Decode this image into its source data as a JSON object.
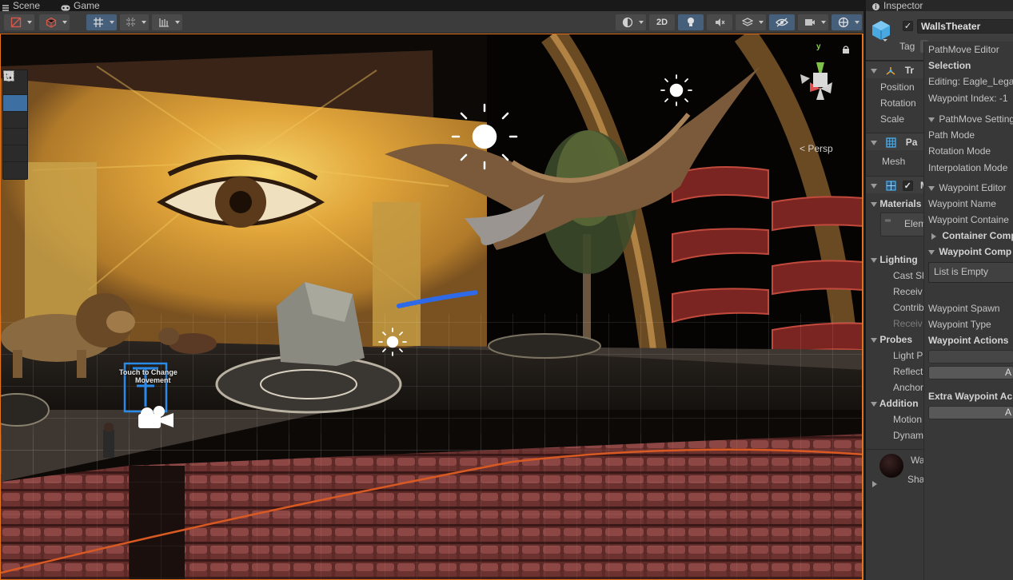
{
  "tabs": {
    "scene": "Scene",
    "game": "Game",
    "inspector": "Inspector"
  },
  "toolbar": {
    "two_d": "2D"
  },
  "viewport": {
    "persp_label": "< Persp",
    "gizmo_axes": {
      "y": "y"
    },
    "stage_sign_title": "Touch to Change",
    "stage_sign_subtitle": "Movement"
  },
  "inspector": {
    "object_name": "WallsTheater",
    "tag_label": "Tag",
    "components": {
      "transform": {
        "title": "Tr",
        "position": "Position",
        "rotation": "Rotation",
        "scale": "Scale"
      },
      "mesh_filter": {
        "title": "Pa",
        "mesh": "Mesh"
      },
      "mesh_renderer": {
        "title": "Me",
        "materials": "Materials",
        "element": "Elem",
        "lighting": "Lighting",
        "cast_shadows": "Cast Sh",
        "receive_shadows": "Receiv",
        "contribute_gi": "Contrib",
        "receive_gi": "Receiv",
        "probes": "Probes",
        "light_probes": "Light P",
        "reflection_probes": "Reflect",
        "anchor_override": "Anchor",
        "additional": "Addition",
        "motion_vectors": "Motion",
        "dynamic_occlusion": "Dynam"
      },
      "material": {
        "name": "Wa",
        "shader": "Sha"
      }
    }
  },
  "pathmove": {
    "title": "PathMove Editor",
    "selection_header": "Selection",
    "editing": "Editing: Eagle_Lega",
    "waypoint_index": "Waypoint Index: -1",
    "settings_header": "PathMove Setting",
    "path_mode": "Path Mode",
    "rotation_mode": "Rotation Mode",
    "interpolation_mode": "Interpolation Mode",
    "waypoint_editor_header": "Waypoint Editor",
    "waypoint_name": "Waypoint Name",
    "waypoint_container": "Waypoint Containe",
    "container_comp": "Container Comp",
    "waypoint_comp": "Waypoint Comp",
    "list_empty": "List is Empty",
    "waypoint_spawn": "Waypoint Spawn",
    "waypoint_type": "Waypoint Type",
    "waypoint_actions": "Waypoint Actions",
    "add_small": "A",
    "extra_waypoint_actions": "Extra Waypoint Ac",
    "add_extra": "A"
  }
}
